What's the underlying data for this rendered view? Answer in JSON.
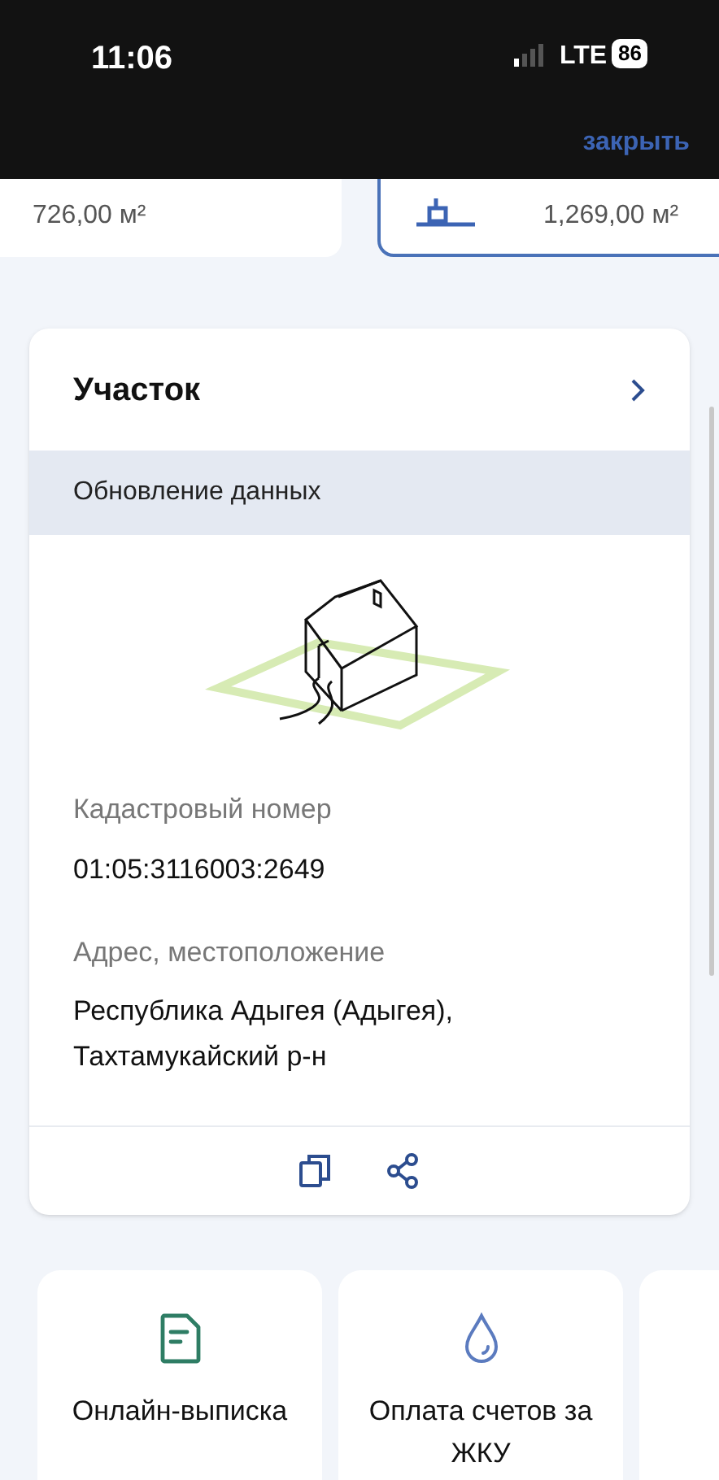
{
  "status_bar": {
    "time": "11:06",
    "network": "LTE",
    "battery": "86"
  },
  "header": {
    "close": "закрыть"
  },
  "area_cards": [
    {
      "value": "726,00 м²",
      "selected": false
    },
    {
      "value": "1,269,00 м²",
      "selected": true
    }
  ],
  "plot_card": {
    "title": "Участок",
    "band": "Обновление данных",
    "fields": [
      {
        "label": "Кадастровый номер",
        "value": "01:05:3116003:2649"
      },
      {
        "label": "Адрес, местоположение",
        "value": "Республика Адыгея (Адыгея), Тахтамукайский р-н"
      }
    ]
  },
  "services": [
    {
      "kind": "document",
      "label": "Онлайн-выписка"
    },
    {
      "kind": "drop",
      "label": "Оплата счетов за ЖКУ"
    },
    {
      "kind": "blank"
    }
  ]
}
